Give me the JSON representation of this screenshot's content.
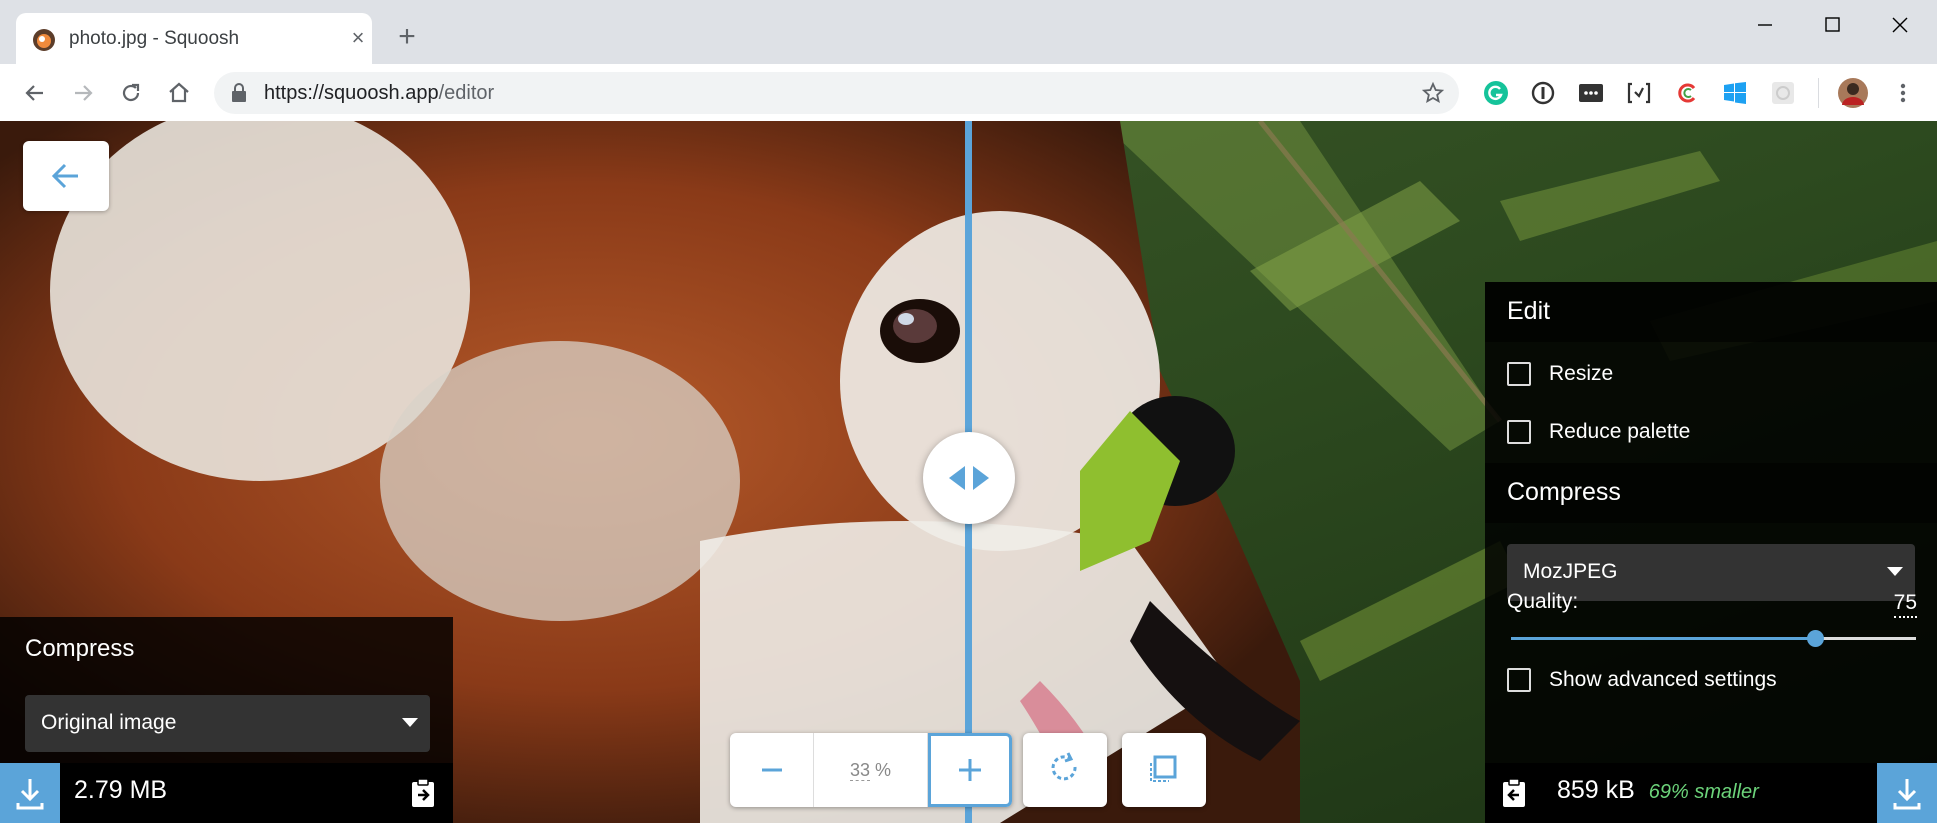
{
  "browser": {
    "tab_title": "photo.jpg - Squoosh",
    "url_host": "https://squoosh.app",
    "url_path": "/editor"
  },
  "left_panel": {
    "title": "Compress",
    "codec": "Original image",
    "file_size": "2.79 MB"
  },
  "right_panel": {
    "edit_title": "Edit",
    "resize_label": "Resize",
    "reduce_palette_label": "Reduce palette",
    "compress_title": "Compress",
    "codec": "MozJPEG",
    "quality_label": "Quality:",
    "quality_value": "75",
    "quality_fraction": 0.75,
    "advanced_label": "Show advanced settings",
    "file_size": "859 kB",
    "savings": "69% smaller"
  },
  "zoom": {
    "value": "33",
    "unit": "%"
  },
  "colors": {
    "accent": "#5ba4d9",
    "savings_green": "#6cd37a"
  },
  "icons": [
    "back-arrow-icon",
    "split-arrows-icon",
    "download-icon",
    "copy-settings-icon",
    "minus-icon",
    "plus-icon",
    "rotate-icon",
    "background-toggle-icon",
    "lock-icon",
    "star-icon"
  ]
}
